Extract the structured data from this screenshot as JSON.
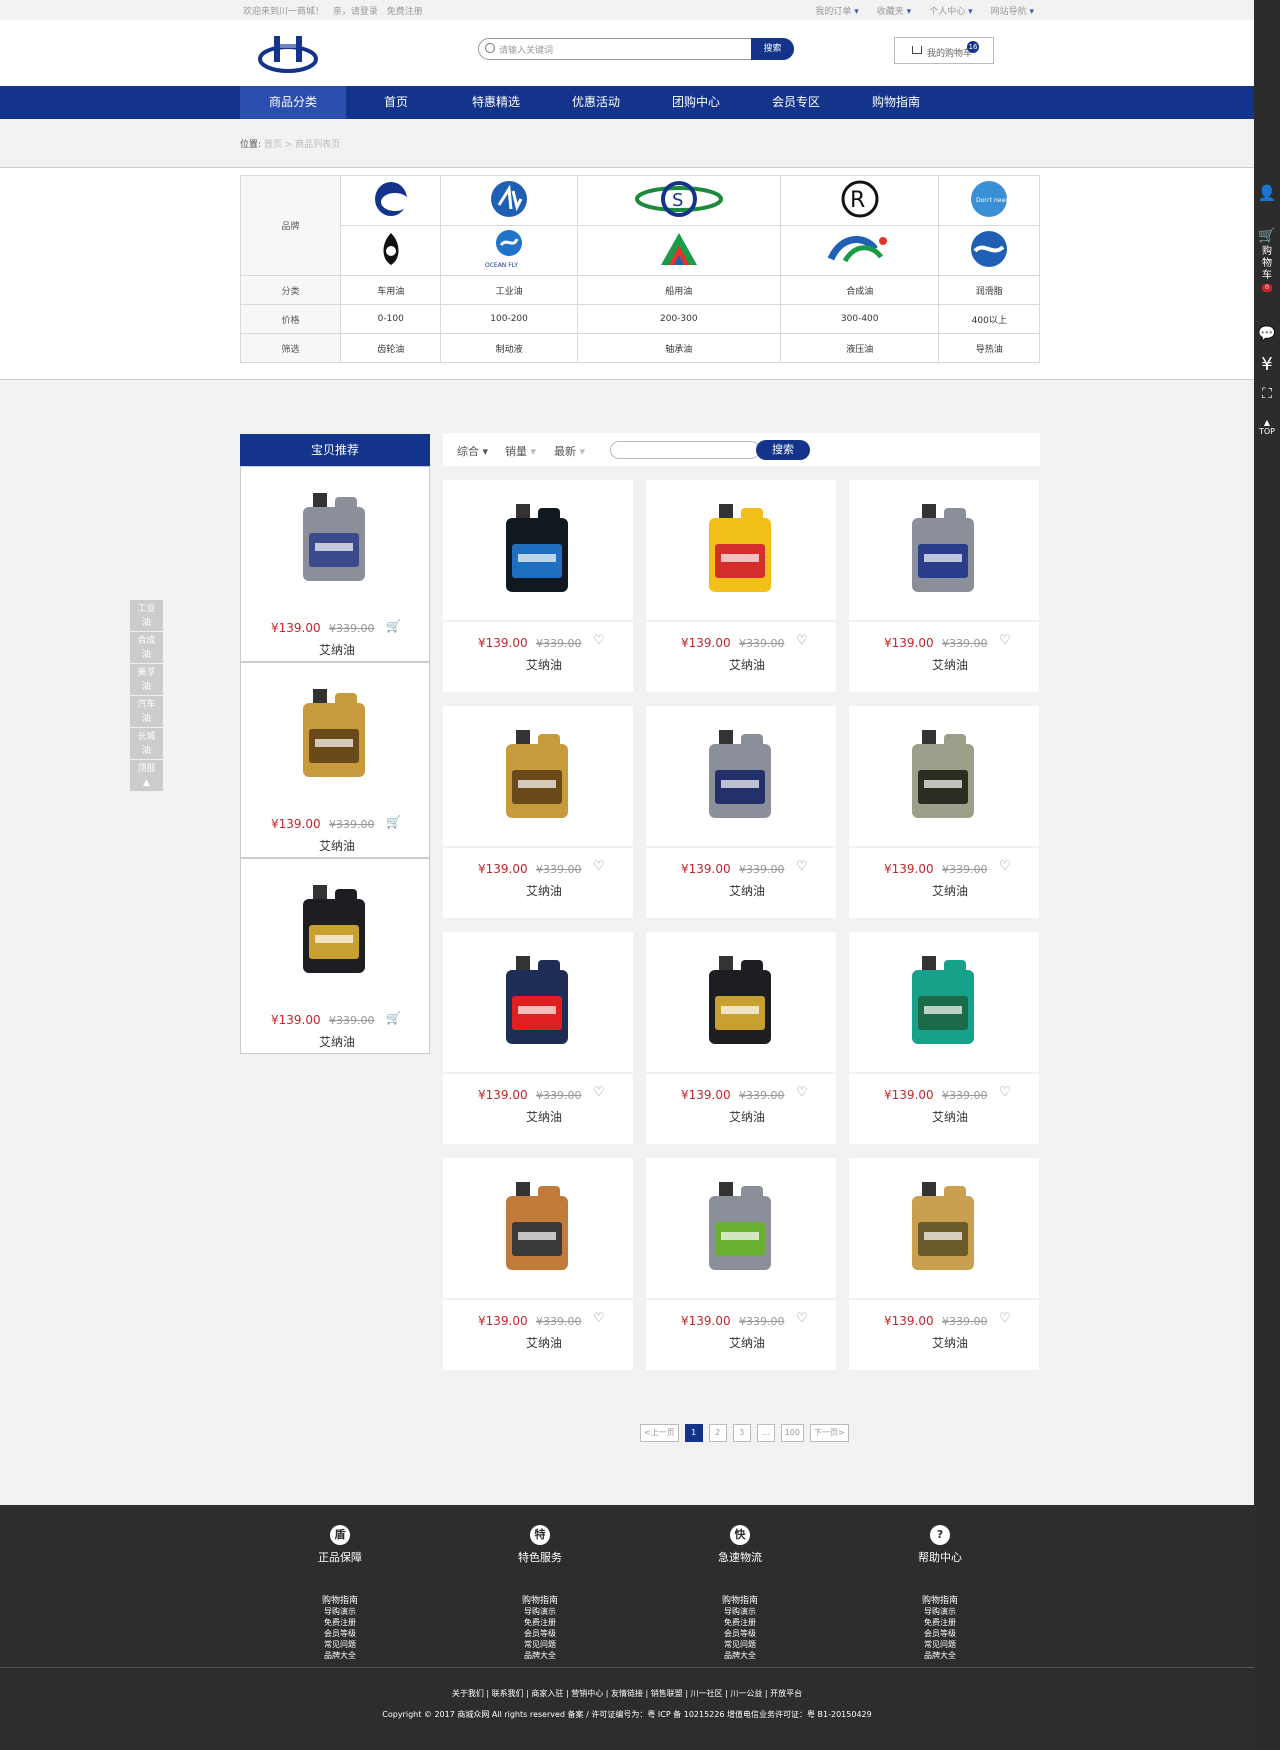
{
  "topbar": {
    "welcome": "欢迎来到川一商城！",
    "login": "亲，请登录",
    "register": "免费注册",
    "links": [
      "我的订单",
      "收藏夹",
      "个人中心",
      "网站导航"
    ]
  },
  "header": {
    "search_placeholder": "请输入关键词",
    "search_btn": "搜索",
    "cart_label": "我的购物车",
    "cart_count": "16"
  },
  "nav": [
    "商品分类",
    "首页",
    "特惠精选",
    "优惠活动",
    "团购中心",
    "会员专区",
    "购物指南"
  ],
  "breadcrumb": {
    "label": "位置:",
    "path": "首页 > 商品列表页"
  },
  "filter": {
    "brand_label": "品牌",
    "rows": [
      {
        "label": "分类",
        "items": [
          "车用油",
          "工业油",
          "船用油",
          "合成油",
          "润滑脂"
        ]
      },
      {
        "label": "价格",
        "items": [
          "0-100",
          "100-200",
          "200-300",
          "300-400",
          "400以上"
        ]
      },
      {
        "label": "筛选",
        "items": [
          "齿轮油",
          "制动液",
          "轴承油",
          "液压油",
          "导热油"
        ]
      }
    ],
    "brand_texts": [
      "Don't need",
      "OCEAN FLY"
    ]
  },
  "recommend": {
    "title": "宝贝推荐"
  },
  "sortbar": {
    "items": [
      "综合",
      "销量",
      "最新"
    ],
    "search_btn": "搜索"
  },
  "product": {
    "price": "¥139.00",
    "old_price": "¥339.00",
    "name": "艾纳油"
  },
  "pager": [
    "<上一页",
    "1",
    "2",
    "3",
    "...",
    "100",
    "下一页>"
  ],
  "float_menu": [
    "工业油",
    "合成油",
    "美孚油",
    "汽车油",
    "长城油",
    "顶部"
  ],
  "right_side": {
    "cart": "购物车",
    "cart_count": "0",
    "top": "TOP"
  },
  "footer": {
    "features": [
      {
        "icon": "盾",
        "title": "正品保障"
      },
      {
        "icon": "特",
        "title": "特色服务"
      },
      {
        "icon": "快",
        "title": "急速物流"
      },
      {
        "icon": "?",
        "title": "帮助中心"
      }
    ],
    "col_head": "购物指南",
    "col_items": [
      "导购演示",
      "免费注册",
      "会员等级",
      "常见问题",
      "品牌大全"
    ],
    "links": "关于我们  |  联系我们  |  商家入驻  |  营销中心  |  友情链接  |  销售联盟  |  川一社区  |  川一公益  |  开放平台",
    "copyright": "Copyright © 2017 商城众网 All rights reserved 备案 / 许可证编号为：粤 ICP 备 10215226 增值电信业务许可证：粤 B1-20150429"
  },
  "colors": {
    "primary": "#14348c",
    "price": "#c1272d"
  }
}
